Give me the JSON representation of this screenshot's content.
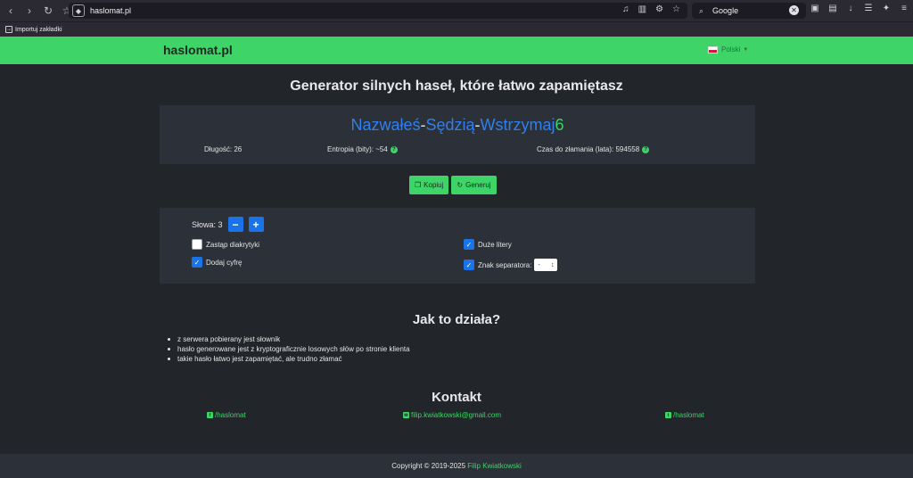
{
  "browser": {
    "url": "haslomat.pl",
    "search_engine": "Google",
    "bookmark": "Importuj zakładki"
  },
  "header": {
    "brand": "haslomat.pl",
    "language": "Polski"
  },
  "heading": "Generator silnych haseł, które łatwo zapamiętasz",
  "password": {
    "word1": "Nazwałeś",
    "sep1": "-",
    "word2": "Sędzią",
    "sep2": "-",
    "word3": "Wstrzymaj",
    "digit": "6"
  },
  "stats": {
    "length": "Długość: 26",
    "entropy": "Entropia (bity): ~54",
    "crack_time": "Czas do złamania (lata): 594558"
  },
  "actions": {
    "copy": "Kopiuj",
    "generate": "Generuj"
  },
  "options": {
    "words_label": "Słowa: 3",
    "minus": "−",
    "plus": "+",
    "replace_diacritics": "Zastąp diakrytyki",
    "add_digit": "Dodaj cyfrę",
    "uppercase": "Duże litery",
    "separator_label": "Znak separatora:",
    "separator_value": "-"
  },
  "how": {
    "title": "Jak to działa?",
    "items": [
      "z serwera pobierany jest słownik",
      "hasło generowane jest z kryptograficznie losowych słów po stronie klienta",
      "takie hasło łatwo jest zapamiętać, ale trudno złamać"
    ]
  },
  "contact": {
    "title": "Kontakt",
    "facebook": "/haslomat",
    "email": "filip.kwiatkowski@gmail.com",
    "twitter": "/haslomat"
  },
  "footer": {
    "copyright": "Copyright © 2019-2025",
    "author": "Filip Kwiatkowski"
  },
  "colors": {
    "brand_green": "#3ed468",
    "password_blue": "#2f80ed",
    "button_blue": "#1a73e8",
    "background": "#22252a",
    "panel": "#2c3038"
  }
}
